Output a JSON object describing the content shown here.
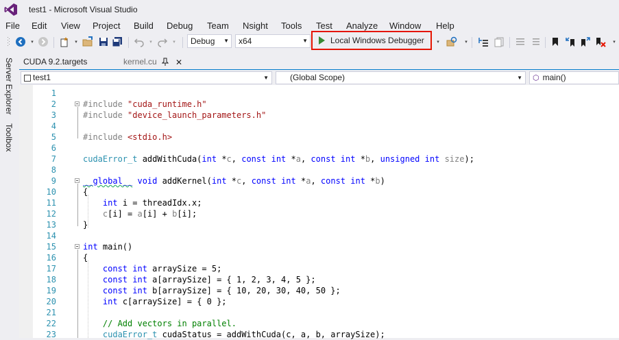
{
  "window": {
    "title": "test1 - Microsoft Visual Studio"
  },
  "menu": [
    "File",
    "Edit",
    "View",
    "Project",
    "Build",
    "Debug",
    "Team",
    "Nsight",
    "Tools",
    "Test",
    "Analyze",
    "Window",
    "Help"
  ],
  "toolbar": {
    "configuration": "Debug",
    "platform": "x64",
    "debugger_label": "Local Windows Debugger"
  },
  "sidebar": {
    "server_explorer": "Server Explorer",
    "toolbox": "Toolbox"
  },
  "tabs": [
    {
      "label": "CUDA 9.2.targets"
    },
    {
      "label": "kernel.cu"
    }
  ],
  "navbar": {
    "project": "test1",
    "scope": "(Global Scope)",
    "member": "main()"
  },
  "code_lines": [
    {
      "n": "1",
      "html": ""
    },
    {
      "n": "2",
      "html": "<span class='pp'>#include</span> <span class='str'>\"cuda_runtime.h\"</span>"
    },
    {
      "n": "3",
      "html": "<span class='pp'>#include</span> <span class='str'>\"device_launch_parameters.h\"</span>"
    },
    {
      "n": "4",
      "html": ""
    },
    {
      "n": "5",
      "html": "<span class='pp'>#include</span> <span class='str'>&lt;stdio.h&gt;</span>"
    },
    {
      "n": "6",
      "html": ""
    },
    {
      "n": "7",
      "html": "<span class='ty'>cudaError_t</span> addWithCuda(<span class='kw'>int</span> *<span class='pa'>c</span>, <span class='kw'>const</span> <span class='kw'>int</span> *<span class='pa'>a</span>, <span class='kw'>const</span> <span class='kw'>int</span> *<span class='pa'>b</span>, <span class='kw'>unsigned</span> <span class='kw'>int</span> <span class='pa'>size</span>);"
    },
    {
      "n": "8",
      "html": ""
    },
    {
      "n": "9",
      "html": "<span class='squiggle'><span class='kw'>__global__</span></span> <span class='kw'>void</span> addKernel(<span class='kw'>int</span> *<span class='pa'>c</span>, <span class='kw'>const</span> <span class='kw'>int</span> *<span class='pa'>a</span>, <span class='kw'>const</span> <span class='kw'>int</span> *<span class='pa'>b</span>)"
    },
    {
      "n": "10",
      "html": "{"
    },
    {
      "n": "11",
      "html": "    <span class='kw'>int</span> i = threadIdx.x;"
    },
    {
      "n": "12",
      "html": "    <span class='pa'>c</span>[i] = <span class='pa'>a</span>[i] + <span class='pa'>b</span>[i];"
    },
    {
      "n": "13",
      "html": "}"
    },
    {
      "n": "14",
      "html": ""
    },
    {
      "n": "15",
      "html": "<span class='kw'>int</span> main()"
    },
    {
      "n": "16",
      "html": "{"
    },
    {
      "n": "17",
      "html": "    <span class='kw'>const</span> <span class='kw'>int</span> arraySize = 5;"
    },
    {
      "n": "18",
      "html": "    <span class='kw'>const</span> <span class='kw'>int</span> a[arraySize] = { 1, 2, 3, 4, 5 };"
    },
    {
      "n": "19",
      "html": "    <span class='kw'>const</span> <span class='kw'>int</span> b[arraySize] = { 10, 20, 30, 40, 50 };"
    },
    {
      "n": "20",
      "html": "    <span class='kw'>int</span> c[arraySize] = { 0 };"
    },
    {
      "n": "21",
      "html": ""
    },
    {
      "n": "22",
      "html": "    <span class='cm'>// Add vectors in parallel.</span>"
    },
    {
      "n": "23",
      "html": "    <span class='ty'>cudaError_t</span> cudaStatus = addWithCuda(c, a, b, arraySize);"
    }
  ]
}
